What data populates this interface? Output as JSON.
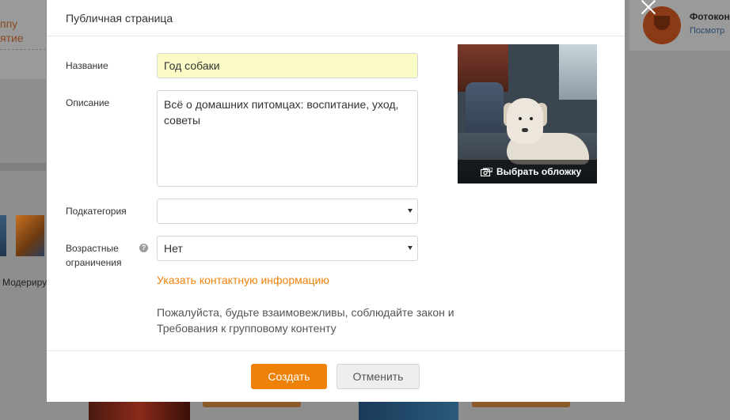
{
  "background": {
    "left_link_line1": "ппу",
    "left_link_line2": "ятие",
    "left_moderate": "Модериру",
    "right_card_title": "Фотокон",
    "right_card_subtitle": "Посмотр"
  },
  "modal": {
    "title": "Публичная страница",
    "fields": {
      "name_label": "Название",
      "name_value": "Год собаки",
      "description_label": "Описание",
      "description_value": "Всё о домашних питомцах: воспитание, уход, советы",
      "subcategory_label": "Подкатегория",
      "subcategory_value": "",
      "age_label": "Возрастные ограничения",
      "age_help": "?",
      "age_value": "Нет"
    },
    "contact_link": "Указать контактную информацию",
    "notice": "Пожалуйста, будьте взаимовежливы, соблюдайте закон и Требования к групповому контенту",
    "cover_label": "Выбрать обложку",
    "buttons": {
      "create": "Создать",
      "cancel": "Отменить"
    }
  },
  "colors": {
    "accent": "#ee8208",
    "highlight_field": "#fbfbc6",
    "overlay": "#8e8e8e"
  }
}
